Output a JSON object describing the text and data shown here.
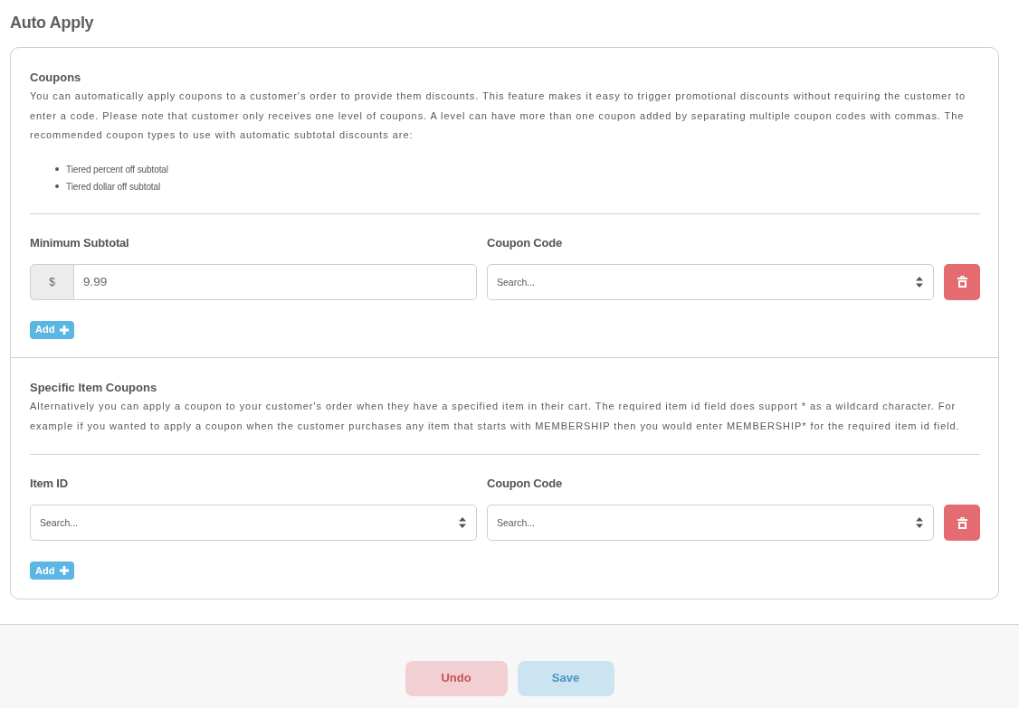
{
  "page_title": "Auto Apply",
  "sections": [
    {
      "title": "Coupons",
      "description": "You can automatically apply coupons to a customer's order to provide them discounts. This feature makes it easy to trigger promotional discounts without requiring the customer to enter a code. Please note that customer only receives one level of coupons. A level can have more than one coupon added by separating multiple coupon codes with commas. The recommended coupon types to use with automatic subtotal discounts are:",
      "bullets": [
        "Tiered percent off subtotal",
        "Tiered dollar off subtotal"
      ],
      "columns": [
        "Minimum Subtotal",
        "Coupon Code"
      ],
      "rows": [
        {
          "fields": [
            {
              "kind": "amount",
              "prefix": "$",
              "value": "9.99"
            },
            {
              "kind": "select",
              "placeholder": "Search..."
            }
          ]
        }
      ],
      "add_button": "Add"
    },
    {
      "title": "Specific Item Coupons",
      "description": "Alternatively you can apply a coupon to your customer's order when they have a specified item in their cart. The required item id field does support * as a wildcard character. For example if you wanted to apply a coupon when the customer purchases any item that starts with MEMBERSHIP then you would enter MEMBERSHIP* for the required item id field.",
      "columns": [
        "Item ID",
        "Coupon Code"
      ],
      "rows": [
        {
          "fields": [
            {
              "kind": "select",
              "placeholder": "Search..."
            },
            {
              "kind": "select",
              "placeholder": "Search..."
            }
          ]
        }
      ],
      "add_button": "Add"
    }
  ],
  "footer_buttons": [
    {
      "label": "Undo",
      "kind": "danger",
      "disabled": true
    },
    {
      "label": "Save",
      "kind": "primary",
      "disabled": true
    }
  ]
}
